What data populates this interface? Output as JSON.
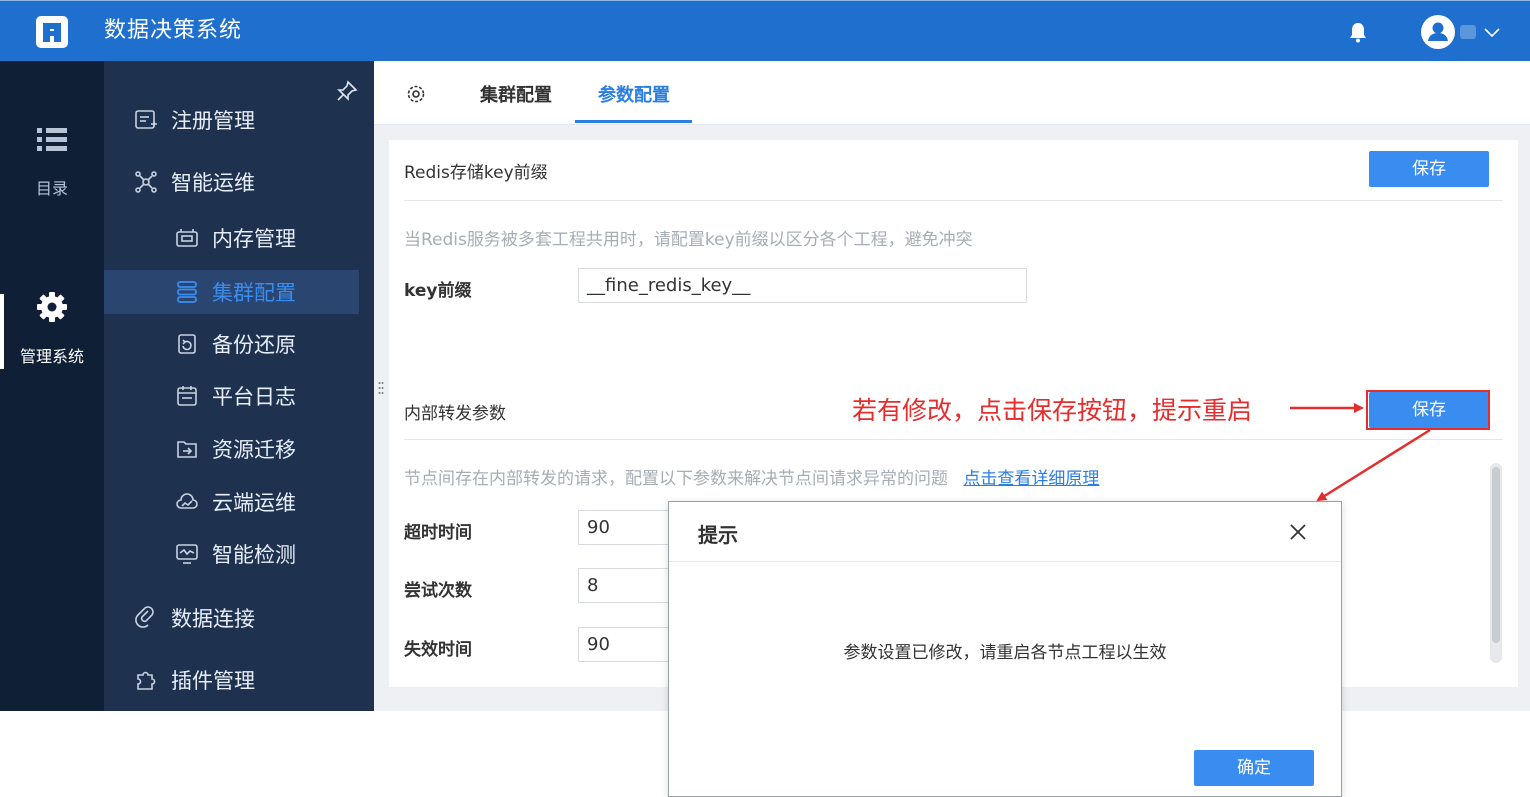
{
  "header": {
    "title": "数据决策系统",
    "logo_icon": "finereport-logo",
    "bell_icon": "bell-icon",
    "user_menu_icon": "chevron-down-icon"
  },
  "rail": {
    "items": [
      {
        "label": "目录",
        "icon": "list-icon"
      },
      {
        "label": "管理系统",
        "icon": "gear-icon",
        "active": true
      }
    ]
  },
  "menu": {
    "items": [
      {
        "label": "注册管理",
        "icon": "register-icon",
        "level": 1
      },
      {
        "label": "智能运维",
        "icon": "ops-icon",
        "level": 1
      },
      {
        "label": "内存管理",
        "icon": "memory-icon",
        "level": 2
      },
      {
        "label": "集群配置",
        "icon": "cluster-icon",
        "level": 2,
        "active": true
      },
      {
        "label": "备份还原",
        "icon": "backup-icon",
        "level": 2
      },
      {
        "label": "平台日志",
        "icon": "log-icon",
        "level": 2
      },
      {
        "label": "资源迁移",
        "icon": "migrate-icon",
        "level": 2
      },
      {
        "label": "云端运维",
        "icon": "cloud-ops-icon",
        "level": 2
      },
      {
        "label": "智能检测",
        "icon": "monitor-icon",
        "level": 2
      },
      {
        "label": "数据连接",
        "icon": "link-icon",
        "level": 1
      },
      {
        "label": "插件管理",
        "icon": "puzzle-icon",
        "level": 1
      }
    ]
  },
  "tabs": {
    "settings_icon": "gear-icon",
    "items": [
      {
        "label": "集群配置",
        "active": false
      },
      {
        "label": "参数配置",
        "active": true
      }
    ]
  },
  "redis_card": {
    "title": "Redis存储key前缀",
    "save_label": "保存",
    "description": "当Redis服务被多套工程共用时，请配置key前缀以区分各个工程，避免冲突",
    "key_label": "key前缀",
    "key_value": "__fine_redis_key__"
  },
  "forward_card": {
    "title": "内部转发参数",
    "save_label": "保存",
    "description": "节点间存在内部转发的请求，配置以下参数来解决节点间请求异常的问题",
    "detail_link": "点击查看详细原理",
    "fields": [
      {
        "label": "超时时间",
        "value": "90"
      },
      {
        "label": "尝试次数",
        "value": "8"
      },
      {
        "label": "失效时间",
        "value": "90"
      }
    ]
  },
  "annotation": {
    "text": "若有修改，点击保存按钮，提示重启",
    "color": "#e52d2d"
  },
  "dialog": {
    "title": "提示",
    "message": "参数设置已修改，请重启各节点工程以生效",
    "ok_label": "确定",
    "close_icon": "close-icon"
  },
  "colors": {
    "topbar": "#1f6fce",
    "rail": "#0f1f36",
    "menu": "#1e3250",
    "accent": "#2b7fe0",
    "button": "#3a8df0"
  }
}
